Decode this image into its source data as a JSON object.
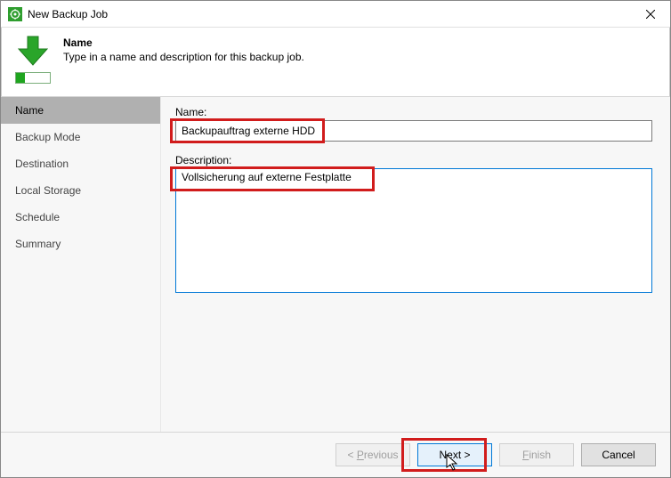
{
  "titlebar": {
    "title": "New Backup Job"
  },
  "header": {
    "title": "Name",
    "subtitle": "Type in a name and description for this backup job."
  },
  "sidebar": {
    "items": [
      {
        "label": "Name"
      },
      {
        "label": "Backup Mode"
      },
      {
        "label": "Destination"
      },
      {
        "label": "Local Storage"
      },
      {
        "label": "Schedule"
      },
      {
        "label": "Summary"
      }
    ],
    "selected_index": 0
  },
  "form": {
    "name_label": "Name:",
    "name_value": "Backupauftrag externe HDD",
    "desc_label": "Description:",
    "desc_value": "Vollsicherung auf externe Festplatte"
  },
  "footer": {
    "prev_mnemonic": "P",
    "prev_rest": "revious",
    "next_first": "N",
    "next_mnemonic": "e",
    "next_rest": "xt >",
    "finish_mnemonic": "F",
    "finish_rest": "inish",
    "cancel": "Cancel"
  }
}
